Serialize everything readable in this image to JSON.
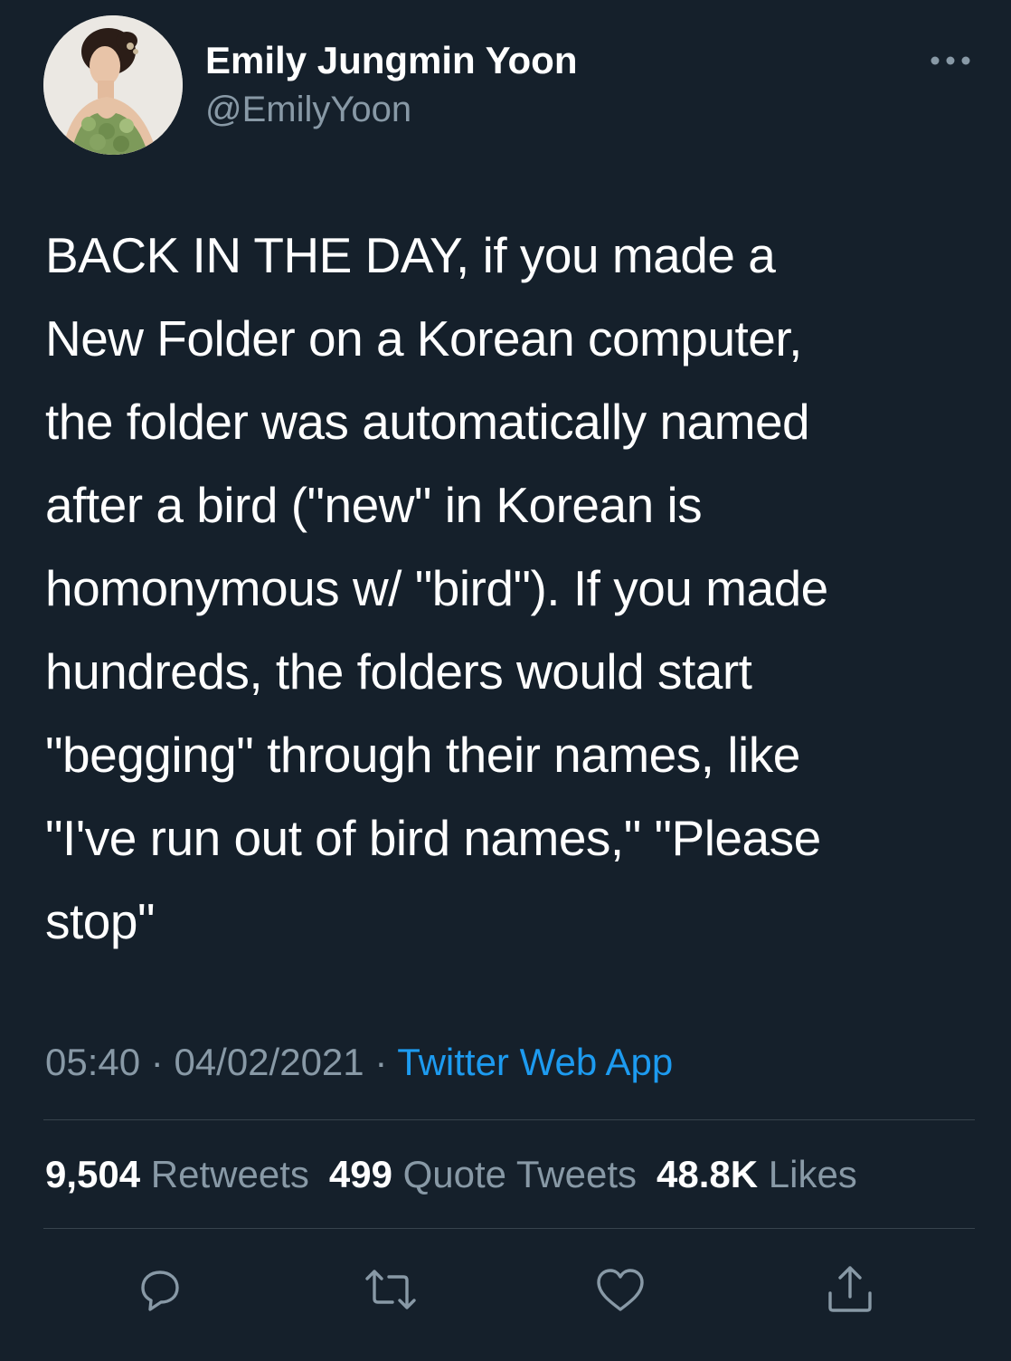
{
  "user": {
    "display_name": "Emily Jungmin Yoon",
    "handle": "@EmilyYoon",
    "avatar_icon": "profile-photo"
  },
  "more_icon": "more-options-icon",
  "tweet": {
    "text": "BACK IN THE DAY, if you made a\nNew Folder on a Korean computer,\nthe folder was automatically named\nafter a bird (\"new\" in Korean is\nhomonymous w/ \"bird\"). If you made\nhundreds, the folders would start\n\"begging\" through their names, like\n\"I've run out of bird names,\" \"Please\nstop\""
  },
  "meta": {
    "time": "05:40",
    "separator1": " · ",
    "date": "04/02/2021",
    "separator2": " · ",
    "source": "Twitter Web App"
  },
  "stats": {
    "retweets_count": "9,504",
    "retweets_label": "Retweets",
    "quotes_count": "499",
    "quotes_label": "Quote Tweets",
    "likes_count": "48.8K",
    "likes_label": "Likes"
  },
  "actions": [
    "reply-icon",
    "retweet-icon",
    "like-icon",
    "share-icon"
  ],
  "colors": {
    "background": "#15202b",
    "text": "#ffffff",
    "secondary": "#8899a6",
    "link": "#1d9bf0",
    "divider": "#38444d"
  }
}
